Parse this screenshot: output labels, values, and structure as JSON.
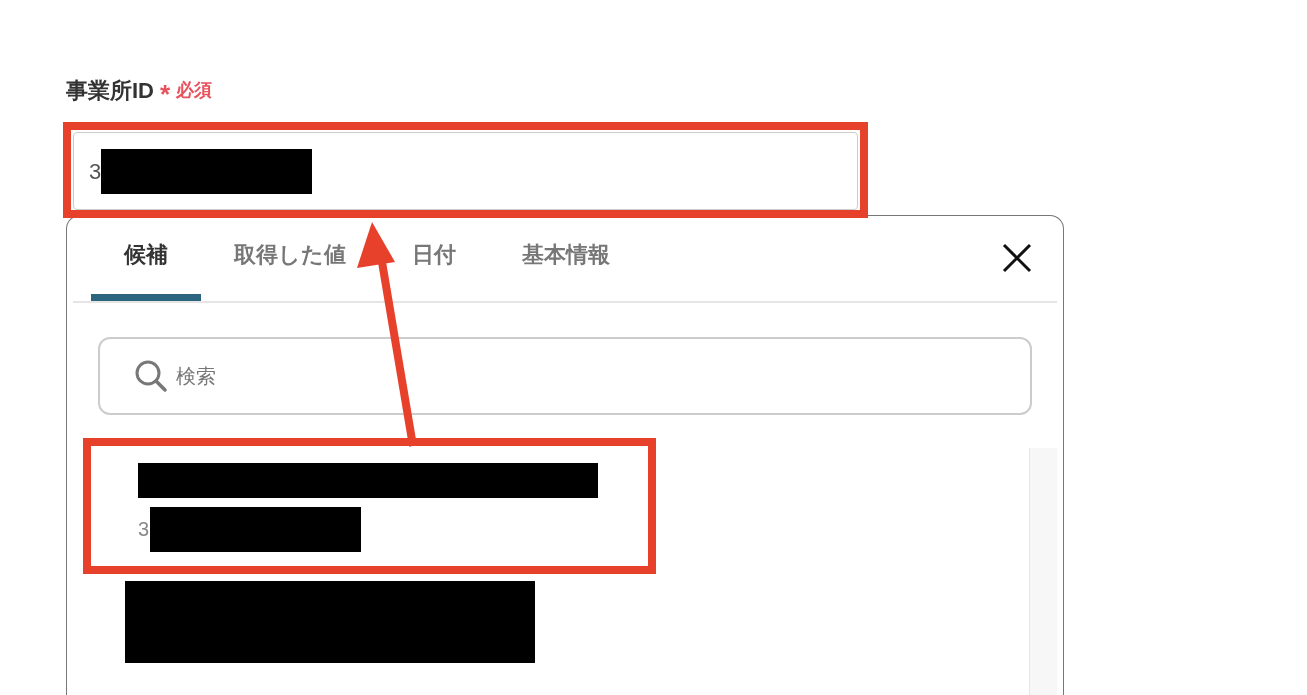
{
  "field": {
    "label": "事業所ID",
    "required_mark": "*",
    "required_text": "必須",
    "value": "3",
    "highlighted": true
  },
  "picker": {
    "tabs": [
      {
        "label": "候補",
        "selected": true
      },
      {
        "label": "取得した値",
        "selected": false
      },
      {
        "label": "日付",
        "selected": false
      },
      {
        "label": "基本情報",
        "selected": false
      }
    ],
    "search": {
      "placeholder": "検索"
    },
    "results": [
      {
        "kind": "titled",
        "subtitle": "3",
        "highlighted": true
      },
      {
        "kind": "redacted",
        "highlighted": false
      }
    ]
  }
}
